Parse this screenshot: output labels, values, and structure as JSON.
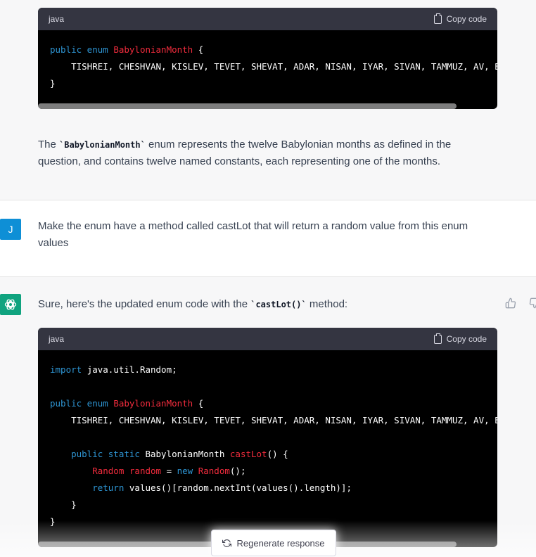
{
  "code_block_1": {
    "language": "java",
    "copy_label": "Copy code",
    "lines": [
      [
        "kw:public enum ",
        "cls:BabylonianMonth",
        "plain: {"
      ],
      [
        "plain:    TISHREI, CHESHVAN, KISLEV, TEVET, SHEVAT, ADAR, NISAN, IYAR, SIVAN, TAMMUZ, AV, ELUL"
      ],
      [
        "plain:}"
      ]
    ]
  },
  "explanation": {
    "before": "The ",
    "code": "`BabylonianMonth`",
    "after": " enum represents the twelve Babylonian months as defined in the question, and contains twelve named constants, each representing one of the months."
  },
  "user_message": {
    "avatar_letter": "J",
    "text": "Make the enum have a method called castLot that will return a random value from this enum values"
  },
  "assistant_message": {
    "intro_before": "Sure, here's the updated enum code with the ",
    "intro_code": "`castLot()`",
    "intro_after": " method:"
  },
  "code_block_2": {
    "language": "java",
    "copy_label": "Copy code",
    "lines": [
      [
        "kw:import ",
        "plain:java.util.Random;"
      ],
      [
        "plain:"
      ],
      [
        "kw:public enum ",
        "cls:BabylonianMonth",
        "plain: {"
      ],
      [
        "plain:    TISHREI, CHESHVAN, KISLEV, TEVET, SHEVAT, ADAR, NISAN, IYAR, SIVAN, TAMMUZ, AV, ELUL;"
      ],
      [
        "plain:"
      ],
      [
        "kw:    public static ",
        "plain:BabylonianMonth ",
        "cls:castLot",
        "plain:() {"
      ],
      [
        "cls:        Random ",
        "cls:random",
        "plain: = ",
        "kw:new ",
        "cls:Random",
        "plain:();"
      ],
      [
        "kw:        return ",
        "plain:values()[random.nextInt(values().length)];"
      ],
      [
        "plain:    }"
      ],
      [
        "plain:}"
      ]
    ]
  },
  "regenerate_label": "Regenerate response",
  "colors": {
    "user_avatar": "#0e8fd6",
    "bot_avatar": "#10a37f",
    "code_keyword": "#2e95d3",
    "code_class": "#f22c3d"
  }
}
